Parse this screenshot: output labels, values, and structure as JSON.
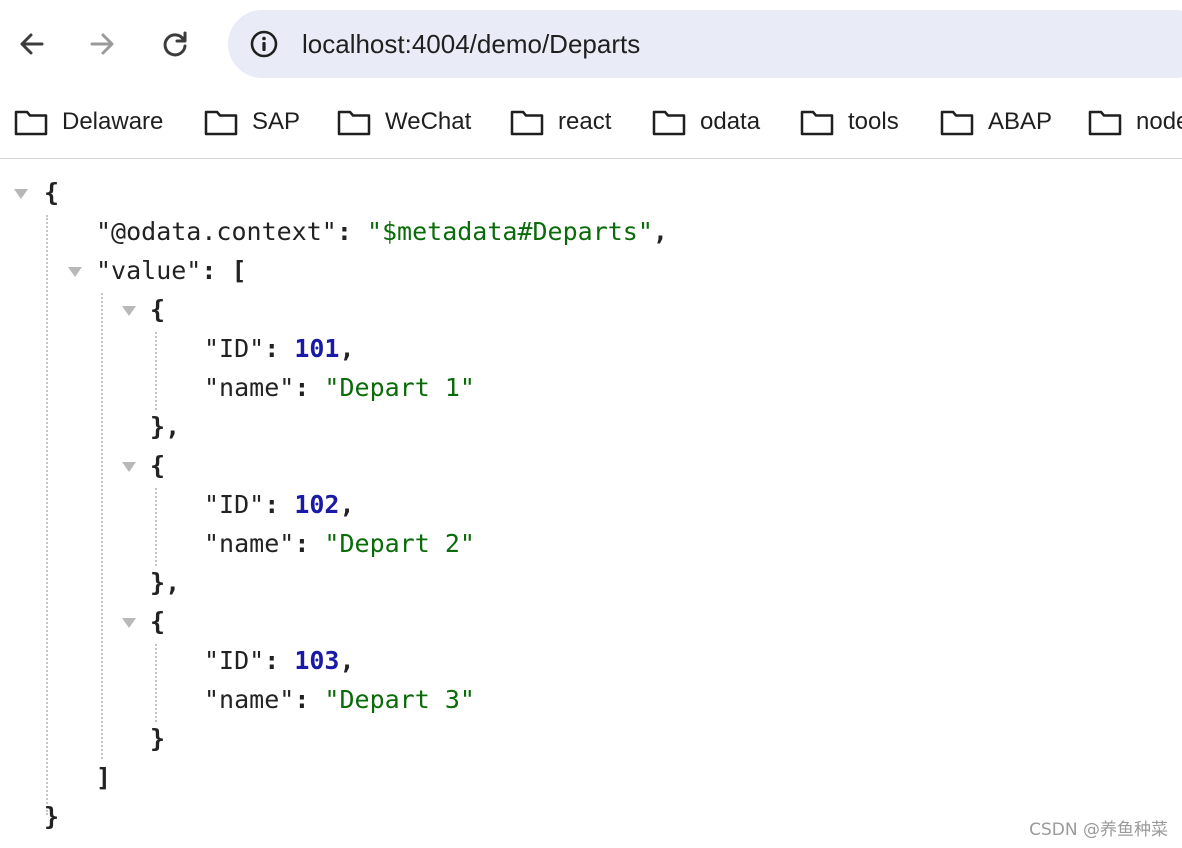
{
  "browser": {
    "url": "localhost:4004/demo/Departs",
    "icons": {
      "back": "arrow-left-icon",
      "forward": "arrow-right-icon",
      "reload": "reload-icon",
      "site_info": "info-circle-icon",
      "bookmark_folder": "folder-icon"
    },
    "bookmarks": [
      "Delaware",
      "SAP",
      "WeChat",
      "react",
      "odata",
      "tools",
      "ABAP",
      "node"
    ]
  },
  "json": {
    "open_brace": "{",
    "close_brace": "}",
    "open_bracket": "[",
    "close_bracket": "]",
    "context_key": "\"@odata.context\"",
    "context_value": "\"$metadata#Departs\"",
    "value_key": "\"value\"",
    "items": [
      {
        "id_key": "\"ID\"",
        "id_value": "101",
        "name_key": "\"name\"",
        "name_value": "\"Depart 1\""
      },
      {
        "id_key": "\"ID\"",
        "id_value": "102",
        "name_key": "\"name\"",
        "name_value": "\"Depart 2\""
      },
      {
        "id_key": "\"ID\"",
        "id_value": "103",
        "name_key": "\"name\"",
        "name_value": "\"Depart 3\""
      }
    ]
  },
  "watermark": "CSDN @养鱼种菜",
  "colors": {
    "string": "#0a6b0a",
    "number": "#1a1aa6",
    "omnibox_bg": "#e9ecf6"
  }
}
